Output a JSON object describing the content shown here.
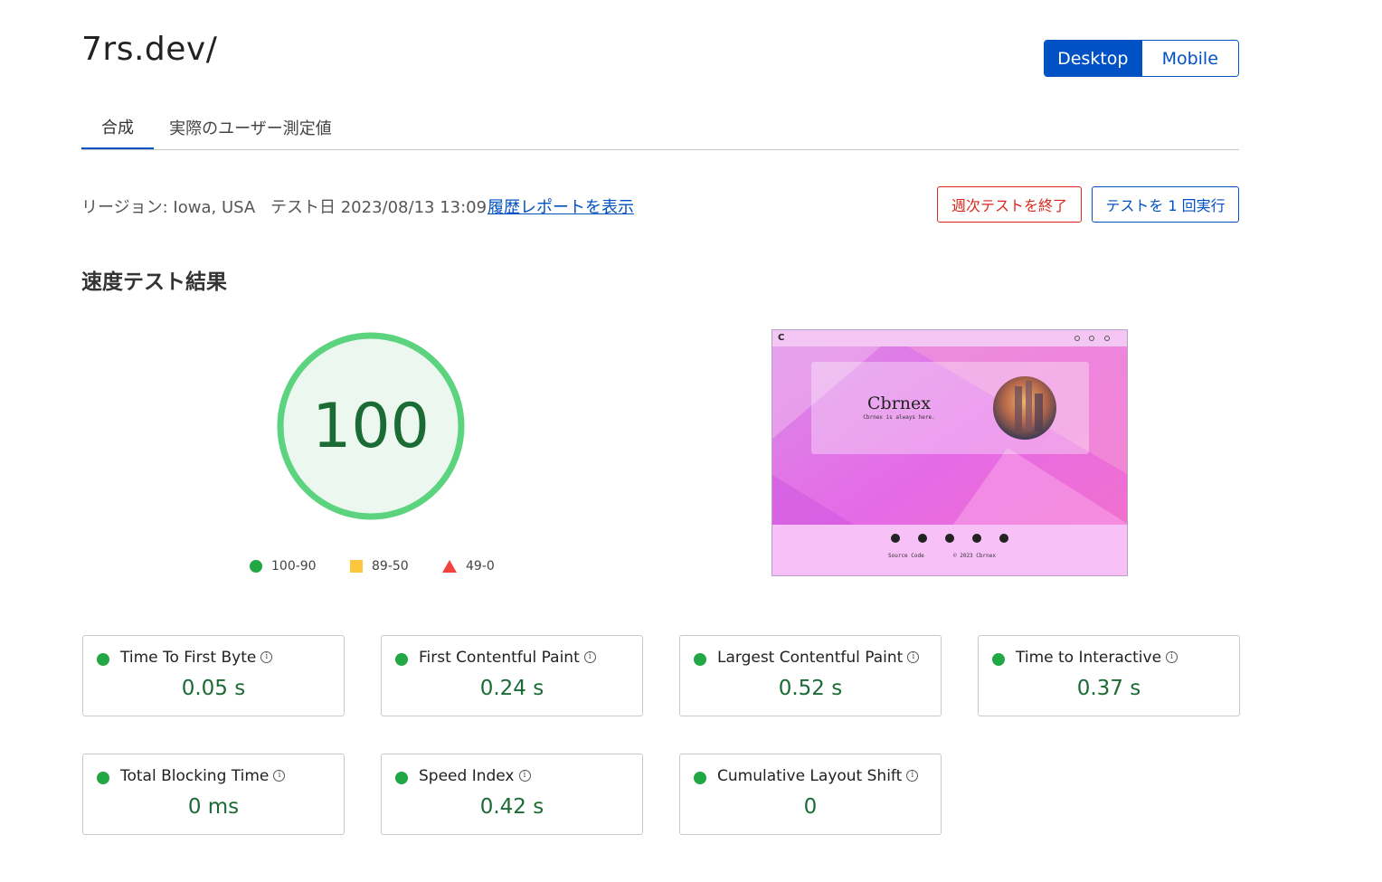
{
  "page": {
    "title": "7rs.dev/",
    "device_toggle": {
      "desktop": "Desktop",
      "mobile": "Mobile",
      "selected": "Desktop"
    }
  },
  "tabs": [
    "合成",
    "実際のユーザー測定値"
  ],
  "meta": {
    "region": "リージョン: Iowa, USA",
    "test_date": "テスト日 2023/08/13 13:09",
    "history_link": "履歴レポートを表示"
  },
  "actions": {
    "stop_weekly": "週次テストを終了",
    "run_once": "テストを 1 回実行"
  },
  "section_title": "速度テスト結果",
  "score": {
    "value": "100",
    "fraction": 1.0,
    "color": "#5cd37f"
  },
  "legend": [
    {
      "shape": "circle",
      "label": "100-90",
      "color": "#22a745"
    },
    {
      "shape": "square",
      "label": "89-50",
      "color": "#fcc63d"
    },
    {
      "shape": "triangle",
      "label": "49-0",
      "color": "#f1423e"
    }
  ],
  "preview": {
    "logo": "C",
    "heading": "Cbrnex",
    "tagline": "Cbrnex is always here.",
    "footer_link": "Source Code",
    "footer_copy": "© 2023 Cbrnex",
    "social_icons": [
      "youtube-icon",
      "twitter-icon",
      "pinterest-icon",
      "telegram-icon",
      "discord-icon"
    ]
  },
  "metrics": [
    {
      "label": "Time To First Byte",
      "value": "0.05 s"
    },
    {
      "label": "First Contentful Paint",
      "value": "0.24 s"
    },
    {
      "label": "Largest Contentful Paint",
      "value": "0.52 s"
    },
    {
      "label": "Time to Interactive",
      "value": "0.37 s"
    },
    {
      "label": "Total Blocking Time",
      "value": "0 ms"
    },
    {
      "label": "Speed Index",
      "value": "0.42 s"
    },
    {
      "label": "Cumulative Layout Shift",
      "value": "0"
    }
  ],
  "info_glyph": "i",
  "colors": {
    "accent": "#0051c3",
    "good": "#22a745",
    "danger": "#d8281c",
    "score_text": "#1b6b34"
  }
}
